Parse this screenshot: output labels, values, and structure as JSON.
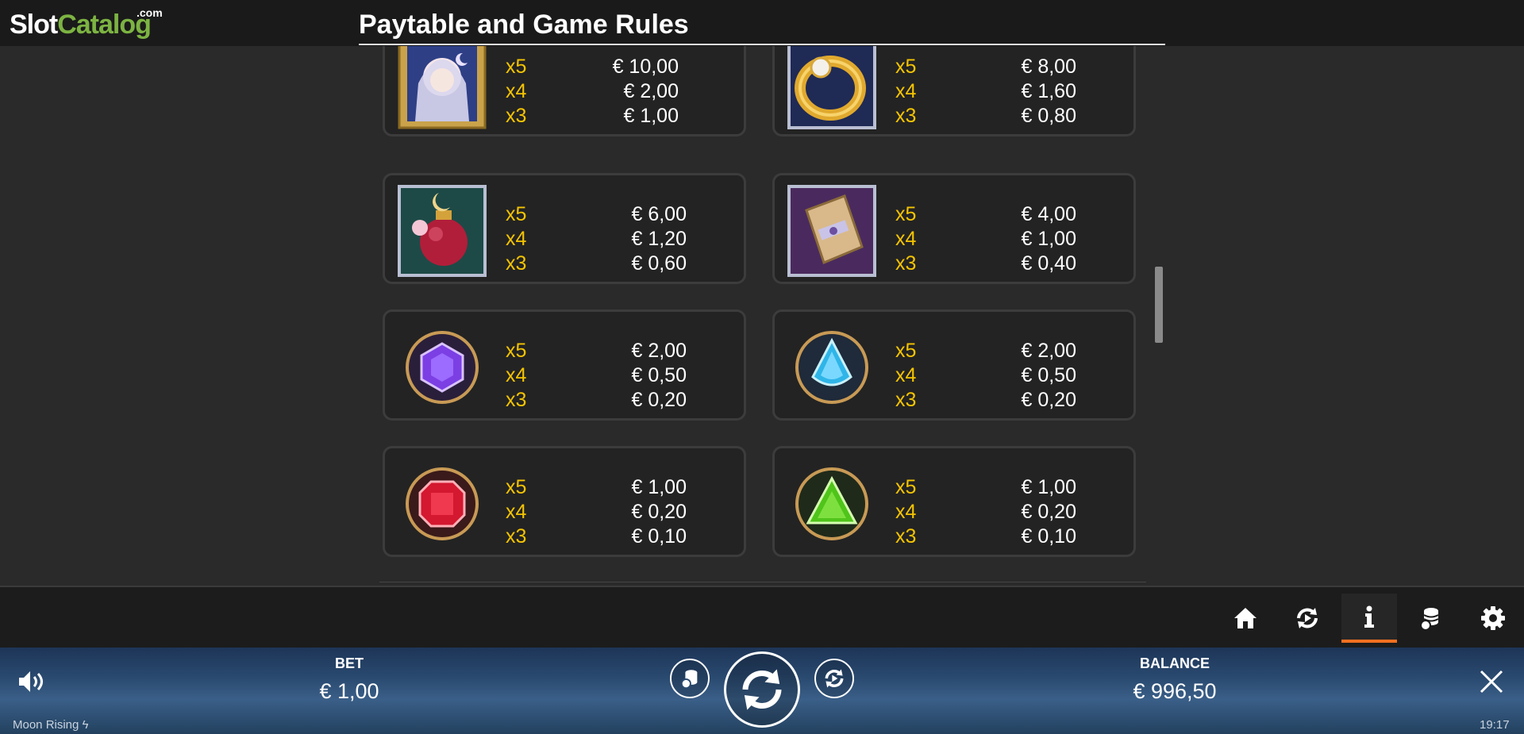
{
  "brand": {
    "logo_slot": "Slot",
    "logo_catalog": "Catalog",
    "logo_com": ".com"
  },
  "header": {
    "title": "Paytable and Game Rules"
  },
  "paytable": [
    {
      "symbol": "moon-princess-icon",
      "rows": [
        {
          "mult": "x5",
          "pay": "€ 10,00"
        },
        {
          "mult": "x4",
          "pay": "€ 2,00"
        },
        {
          "mult": "x3",
          "pay": "€ 1,00"
        }
      ]
    },
    {
      "symbol": "gold-ring-icon",
      "rows": [
        {
          "mult": "x5",
          "pay": "€ 8,00"
        },
        {
          "mult": "x4",
          "pay": "€ 1,60"
        },
        {
          "mult": "x3",
          "pay": "€ 0,80"
        }
      ]
    },
    {
      "symbol": "moon-potion-icon",
      "rows": [
        {
          "mult": "x5",
          "pay": "€ 6,00"
        },
        {
          "mult": "x4",
          "pay": "€ 1,20"
        },
        {
          "mult": "x3",
          "pay": "€ 0,60"
        }
      ]
    },
    {
      "symbol": "scroll-icon",
      "rows": [
        {
          "mult": "x5",
          "pay": "€ 4,00"
        },
        {
          "mult": "x4",
          "pay": "€ 1,00"
        },
        {
          "mult": "x3",
          "pay": "€ 0,40"
        }
      ]
    },
    {
      "symbol": "purple-gem-icon",
      "rows": [
        {
          "mult": "x5",
          "pay": "€ 2,00"
        },
        {
          "mult": "x4",
          "pay": "€ 0,50"
        },
        {
          "mult": "x3",
          "pay": "€ 0,20"
        }
      ]
    },
    {
      "symbol": "blue-gem-icon",
      "rows": [
        {
          "mult": "x5",
          "pay": "€ 2,00"
        },
        {
          "mult": "x4",
          "pay": "€ 0,50"
        },
        {
          "mult": "x3",
          "pay": "€ 0,20"
        }
      ]
    },
    {
      "symbol": "red-gem-icon",
      "rows": [
        {
          "mult": "x5",
          "pay": "€ 1,00"
        },
        {
          "mult": "x4",
          "pay": "€ 0,20"
        },
        {
          "mult": "x3",
          "pay": "€ 0,10"
        }
      ]
    },
    {
      "symbol": "green-gem-icon",
      "rows": [
        {
          "mult": "x5",
          "pay": "€ 1,00"
        },
        {
          "mult": "x4",
          "pay": "€ 0,20"
        },
        {
          "mult": "x3",
          "pay": "€ 0,10"
        }
      ]
    }
  ],
  "nav": {
    "items": [
      {
        "icon": "home-icon"
      },
      {
        "icon": "autoplay-icon"
      },
      {
        "icon": "info-icon",
        "active": true
      },
      {
        "icon": "coins-icon"
      },
      {
        "icon": "gear-icon"
      }
    ],
    "active_color": "#f37021"
  },
  "game": {
    "bet_label": "BET",
    "bet_value": "€ 1,00",
    "balance_label": "BALANCE",
    "balance_value": "€ 996,50",
    "game_name": "Moon Rising",
    "clock": "19:17"
  }
}
